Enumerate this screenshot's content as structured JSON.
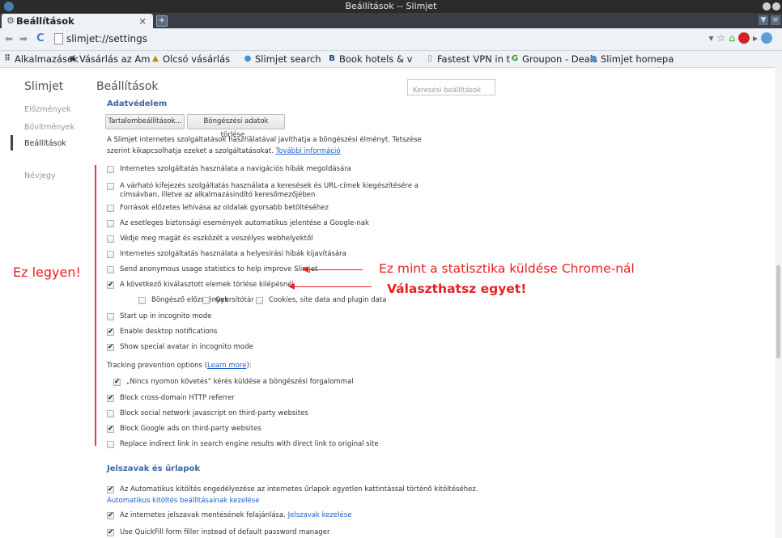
{
  "window": {
    "title": "Beállítások -- Slimjet"
  },
  "tab": {
    "label": "Beállítások",
    "close": "×",
    "new_tab": "+"
  },
  "address": {
    "url": "slimjet://settings"
  },
  "bookmarks": [
    {
      "icon": "apps-icon",
      "glyph": "⠿",
      "color": "#555",
      "label": "Alkalmazások"
    },
    {
      "icon": "amazon-icon",
      "glyph": "a",
      "color": "#222",
      "label": "Vásárlás az Am"
    },
    {
      "icon": "shop-icon",
      "glyph": "▲",
      "color": "#c28b00",
      "label": "Olcsó vásárlás"
    },
    {
      "icon": "slimjet-icon",
      "glyph": "●",
      "color": "#4a8fd1",
      "label": "Slimjet search"
    },
    {
      "icon": "booking-icon",
      "glyph": "B",
      "color": "#1a3f8c",
      "label": "Book hotels & v"
    },
    {
      "icon": "page-icon",
      "glyph": "▯",
      "color": "#888",
      "label": "Fastest VPN in t"
    },
    {
      "icon": "groupon-icon",
      "glyph": "G",
      "color": "#2a9d2a",
      "label": "Groupon - Deals"
    },
    {
      "icon": "slimjet-icon",
      "glyph": "●",
      "color": "#4a8fd1",
      "label": "Slimjet homepa"
    }
  ],
  "sidebar": {
    "title": "Slimjet",
    "items": [
      "Előzmények",
      "Bővítmények",
      "Beállítások",
      "Névjegy"
    ]
  },
  "main": {
    "title": "Beállítások",
    "search_placeholder": "Keresési beállítások"
  },
  "privacy": {
    "title": "Adatvédelem",
    "content_settings_button": "Tartalombeállítások...",
    "clear_data_button": "Böngészési adatok törlése...",
    "description": "A Slimjet internetes szolgáltatások használatával javíthatja a böngészési élményt. Tetszése szerint kikapcsolhatja ezeket a szolgáltatásokat.",
    "more_info_link": "További információ",
    "options": [
      {
        "label": "Internetes szolgáltatás használata a navigációs hibák megoldására",
        "checked": false
      },
      {
        "label": "A várható kifejezés szolgáltatás használata a keresések és URL-címek kiegészítésére a címsávban, illetve az alkalmazásindító keresőmezőjében",
        "checked": false
      },
      {
        "label": "Források előzetes lehívása az oldalak gyorsabb betöltéséhez",
        "checked": false
      },
      {
        "label": "Az esetleges biztonsági események automatikus jelentése a Google-nak",
        "checked": false
      },
      {
        "label": "Védje meg magát és eszközét a veszélyes webhelyektől",
        "checked": false
      },
      {
        "label": "Internetes szolgáltatás használata a helyesírási hibák kijavítására",
        "checked": false
      },
      {
        "label": "Send anonymous usage statistics to help improve Slimjet",
        "checked": false
      },
      {
        "label": "A következő kiválasztott elemek törlése kilépésnél",
        "checked": true
      }
    ],
    "clear_on_exit": [
      {
        "label": "Böngésző előzmények",
        "checked": false
      },
      {
        "label": "Gyorsítótár",
        "checked": false
      },
      {
        "label": "Cookies, site data and plugin data",
        "checked": false
      }
    ],
    "options2": [
      {
        "label": "Start up in incognito mode",
        "checked": false
      },
      {
        "label": "Enable desktop notifications",
        "checked": true
      },
      {
        "label": "Show special avatar in incognito mode",
        "checked": true
      }
    ],
    "tracking_label_prefix": "Tracking prevention options (",
    "tracking_learn_more": "Learn more",
    "tracking_label_suffix": "):",
    "dnt": {
      "label": "„Nincs nyomon követés” kérés küldése a böngészési forgalommal",
      "checked": true
    },
    "options3": [
      {
        "label": "Block cross-domain HTTP referrer",
        "checked": true
      },
      {
        "label": "Block social network javascript on third-party websites",
        "checked": false
      },
      {
        "label": "Block Google ads on third-party websites",
        "checked": true
      },
      {
        "label": "Replace indirect link in search engine results with direct link to original site",
        "checked": false
      }
    ]
  },
  "passwords": {
    "title": "Jelszavak és űrlapok",
    "autofill": {
      "label": "Az Automatikus kitöltés engedélyezése az internetes űrlapok egyetlen kattintással történő kitöltéséhez.",
      "checked": true
    },
    "autofill_link": "Automatikus kitöltés beállításainak kezelése",
    "save_passwords": {
      "label": "Az internetes jelszavak mentésének felajánlása.",
      "checked": true
    },
    "manage_passwords_link": "Jelszavak kezelése",
    "quickfill": {
      "label": "Use QuickFill form filler instead of default password manager",
      "checked": true
    }
  },
  "annotations": {
    "left": "Ez legyen!",
    "stats": "Ez mint a statisztika küldése Chrome-nál",
    "choose": "Választhatsz egyet!",
    "color": "#e81f1f"
  }
}
